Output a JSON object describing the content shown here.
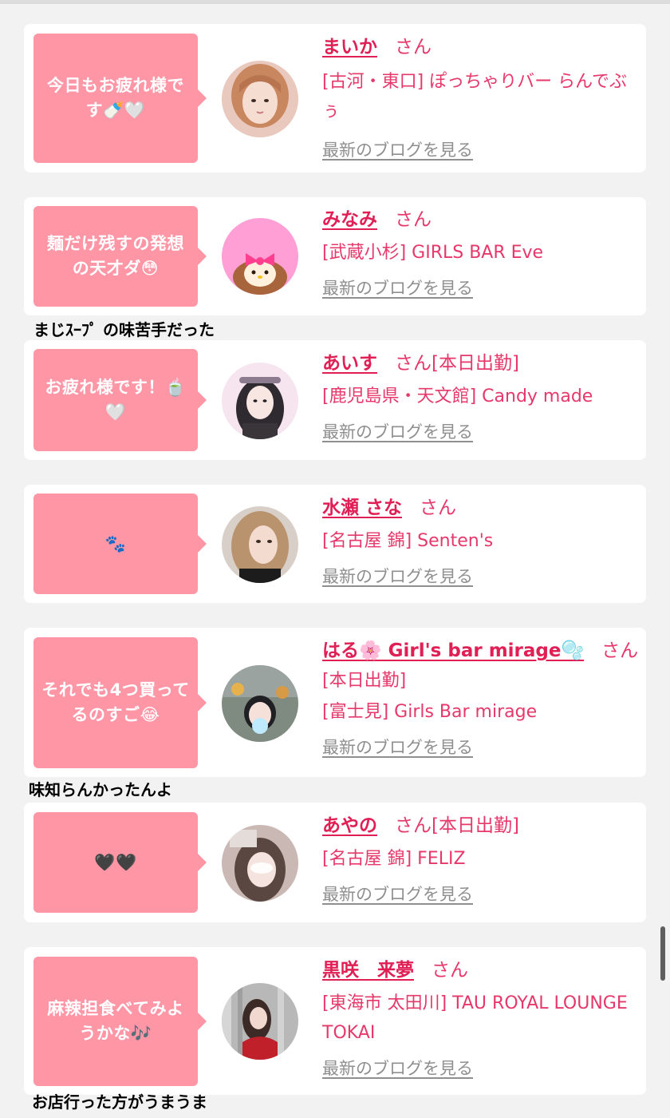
{
  "feed": {
    "blog_link_label": "最新のブログを見る",
    "honorific": "さん",
    "items": [
      {
        "bubble": "今日もお疲れ様です🍼🤍",
        "name": "まいか",
        "tag": "",
        "extra": "",
        "shop": "[古河・東口] ぽっちゃりバー らんでぶぅ"
      },
      {
        "bubble": "麺だけ残すの発想の天才ダ😳",
        "name": "みなみ",
        "tag": "",
        "extra": "",
        "shop": "[武蔵小杉] GIRLS BAR Eve"
      },
      {
        "bubble": "お疲れ様です！🍵🤍",
        "name": "あいす",
        "tag": "[本日出勤]",
        "extra": "",
        "shop": "[鹿児島県・天文館] Candy made"
      },
      {
        "bubble": "🐾",
        "name": "水瀬 さな",
        "tag": "",
        "extra": "",
        "shop": "[名古屋 錦] Senten's"
      },
      {
        "bubble": "それでも4つ買ってるのすご😂",
        "name": "はる🌸 Girl's bar mirage🫧",
        "tag": "",
        "extra": "[本日出勤]",
        "shop": "[富士見] Girls Bar mirage"
      },
      {
        "bubble": "🖤🖤",
        "name": "あやの",
        "tag": "[本日出勤]",
        "extra": "",
        "shop": "[名古屋 錦] FELIZ"
      },
      {
        "bubble": "麻辣担食べてみようかな🎶",
        "name": "黒咲　来夢",
        "tag": "",
        "extra": "",
        "shop": "[東海市 太田川] TAU ROYAL LOUNGE TOKAI"
      }
    ]
  },
  "captions": {
    "c1": "まじｽｰﾌﾟ の味苦手だった",
    "c2": "味知らんかったんよ",
    "c3": "お店行った方がうまうま"
  },
  "colors": {
    "page_background": "#f2f2f2",
    "card_background": "#ffffff",
    "bubble_pink": "#ff96a6",
    "name_color": "#e01f55",
    "shop_color": "#e6386a",
    "blog_link_color": "#8f8f8f"
  }
}
